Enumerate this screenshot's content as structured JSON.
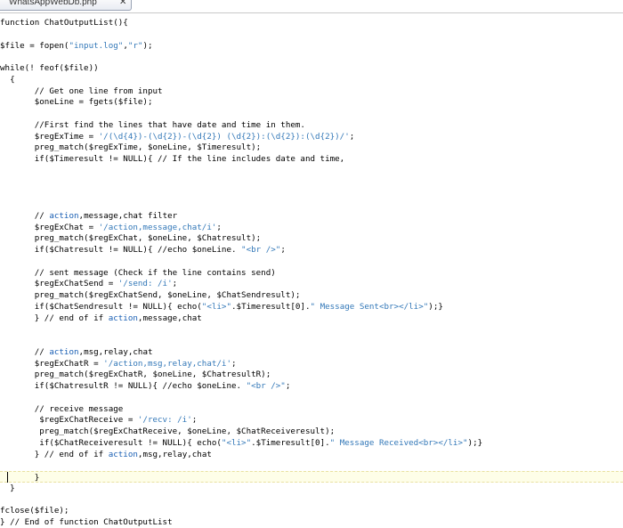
{
  "tab": {
    "title": "WhatsAppWebDb.php",
    "close_glyph": "✕"
  },
  "editor": {
    "current_line_index": 40,
    "lines": [
      [
        [
          "function ChatOutputList(){",
          ""
        ]
      ],
      [
        [
          "",
          ""
        ]
      ],
      [
        [
          "$file = fopen(",
          ""
        ],
        [
          "\"input.log\"",
          "str"
        ],
        [
          ",",
          ""
        ],
        [
          "\"r\"",
          "str"
        ],
        [
          ");",
          ""
        ]
      ],
      [
        [
          "",
          ""
        ]
      ],
      [
        [
          "while(! feof($file))",
          ""
        ]
      ],
      [
        [
          "  {",
          ""
        ]
      ],
      [
        [
          "       // Get one line from input",
          ""
        ]
      ],
      [
        [
          "       $oneLine = fgets($file);",
          ""
        ]
      ],
      [
        [
          "",
          ""
        ]
      ],
      [
        [
          "       //First find the lines that have date and time in them.",
          ""
        ]
      ],
      [
        [
          "       $regExTime = ",
          ""
        ],
        [
          "'/(\\d{4})-(\\d{2})-(\\d{2}) (\\d{2}):(\\d{2}):(\\d{2})/'",
          "str"
        ],
        [
          ";",
          ""
        ]
      ],
      [
        [
          "       preg_match($regExTime, $oneLine, $Timeresult);",
          ""
        ]
      ],
      [
        [
          "       if($Timeresult != NULL){ // If the line includes date and time,",
          ""
        ]
      ],
      [
        [
          "",
          ""
        ]
      ],
      [
        [
          "",
          ""
        ]
      ],
      [
        [
          "",
          ""
        ]
      ],
      [
        [
          "",
          ""
        ]
      ],
      [
        [
          "       // ",
          ""
        ],
        [
          "action",
          "kw"
        ],
        [
          ",message,chat filter",
          ""
        ]
      ],
      [
        [
          "       $regExChat = ",
          ""
        ],
        [
          "'/action,message,chat/i'",
          "str"
        ],
        [
          ";",
          ""
        ]
      ],
      [
        [
          "       preg_match($regExChat, $oneLine, $Chatresult);",
          ""
        ]
      ],
      [
        [
          "       if($Chatresult != NULL){ //echo $oneLine. ",
          ""
        ],
        [
          "\"<br />\"",
          "str"
        ],
        [
          ";",
          ""
        ]
      ],
      [
        [
          "",
          ""
        ]
      ],
      [
        [
          "       // sent message (Check if the line contains send)",
          ""
        ]
      ],
      [
        [
          "       $regExChatSend = ",
          ""
        ],
        [
          "'/send: /i'",
          "str"
        ],
        [
          ";",
          ""
        ]
      ],
      [
        [
          "       preg_match($regExChatSend, $oneLine, $ChatSendresult);",
          ""
        ]
      ],
      [
        [
          "       if($ChatSendresult != NULL){ echo(",
          ""
        ],
        [
          "\"<li>\"",
          "str"
        ],
        [
          ".$Timeresult[0].",
          ""
        ],
        [
          "\" Message Sent<br></li>\"",
          "str"
        ],
        [
          ");}",
          ""
        ]
      ],
      [
        [
          "       } // end of if ",
          ""
        ],
        [
          "action",
          "kw"
        ],
        [
          ",message,chat",
          ""
        ]
      ],
      [
        [
          "",
          ""
        ]
      ],
      [
        [
          "",
          ""
        ]
      ],
      [
        [
          "       // ",
          ""
        ],
        [
          "action",
          "kw"
        ],
        [
          ",msg,relay,chat",
          ""
        ]
      ],
      [
        [
          "       $regExChatR = ",
          ""
        ],
        [
          "'/action,msg,relay,chat/i'",
          "str"
        ],
        [
          ";",
          ""
        ]
      ],
      [
        [
          "       preg_match($regExChatR, $oneLine, $ChatresultR);",
          ""
        ]
      ],
      [
        [
          "       if($ChatresultR != NULL){ //echo $oneLine. ",
          ""
        ],
        [
          "\"<br />\"",
          "str"
        ],
        [
          ";",
          ""
        ]
      ],
      [
        [
          "",
          ""
        ]
      ],
      [
        [
          "       // receive message",
          ""
        ]
      ],
      [
        [
          "        $regExChatReceive = ",
          ""
        ],
        [
          "'/recv: /i'",
          "str"
        ],
        [
          ";",
          ""
        ]
      ],
      [
        [
          "        preg_match($regExChatReceive, $oneLine, $ChatReceiveresult);",
          ""
        ]
      ],
      [
        [
          "        if($ChatReceiveresult != NULL){ echo(",
          ""
        ],
        [
          "\"<li>\"",
          "str"
        ],
        [
          ".$Timeresult[0].",
          ""
        ],
        [
          "\" Message Received<br></li>\"",
          "str"
        ],
        [
          ");}",
          ""
        ]
      ],
      [
        [
          "       } // end of if ",
          ""
        ],
        [
          "action",
          "kw"
        ],
        [
          ",msg,relay,chat",
          ""
        ]
      ],
      [
        [
          "",
          ""
        ]
      ],
      [
        [
          "       }",
          ""
        ]
      ],
      [
        [
          "  }",
          ""
        ]
      ],
      [
        [
          "",
          ""
        ]
      ],
      [
        [
          "fclose($file);",
          ""
        ]
      ],
      [
        [
          "} // End of function ChatOutputList",
          ""
        ]
      ]
    ]
  }
}
